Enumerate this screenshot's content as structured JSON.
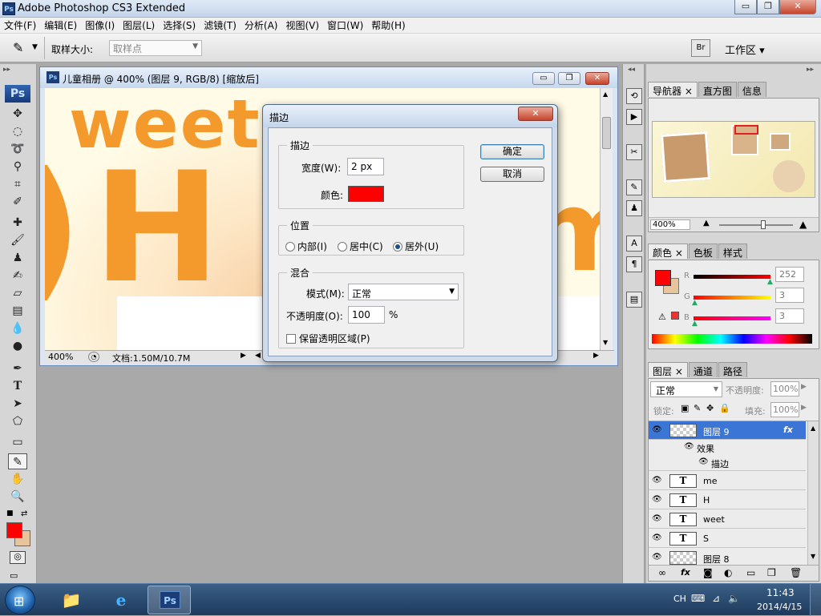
{
  "app": {
    "title": "Adobe Photoshop CS3 Extended",
    "logo": "Ps"
  },
  "window_controls": {
    "minimize": "▭",
    "restore": "❐",
    "close": "✕"
  },
  "menu": [
    "文件(F)",
    "编辑(E)",
    "图像(I)",
    "图层(L)",
    "选择(S)",
    "滤镜(T)",
    "分析(A)",
    "视图(V)",
    "窗口(W)",
    "帮助(H)"
  ],
  "options": {
    "sample_size_label": "取样大小:",
    "sample_size_value": "取样点",
    "workspace_label": "工作区 ▾"
  },
  "toolbox": {
    "logo": "Ps"
  },
  "document": {
    "title": "儿童相册 @ 400% (图层 9, RGB/8) [缩放后]",
    "zoom": "400%",
    "doc_info": "文档:1.50M/10.7M",
    "canvas_texts": {
      "weet": "weet",
      "h": "H",
      "paren": ")",
      "m": "m"
    }
  },
  "dialog": {
    "title": "描边",
    "stroke_group": "描边",
    "width_label": "宽度(W):",
    "width_value": "2 px",
    "color_label": "颜色:",
    "color_value": "#ff0000",
    "position_group": "位置",
    "inside": "内部(I)",
    "center": "居中(C)",
    "outside": "居外(U)",
    "blend_group": "混合",
    "mode_label": "模式(M):",
    "mode_value": "正常",
    "opacity_label": "不透明度(O):",
    "opacity_value": "100",
    "opacity_unit": "%",
    "preserve": "保留透明区域(P)",
    "ok": "确定",
    "cancel": "取消"
  },
  "navigator": {
    "tabs": [
      "导航器",
      "直方图",
      "信息"
    ],
    "zoom": "400%"
  },
  "color_panel": {
    "tabs": [
      "颜色",
      "色板",
      "样式"
    ],
    "r_label": "R",
    "r_value": "252",
    "g_label": "G",
    "g_value": "3",
    "b_label": "B",
    "b_value": "3",
    "foreground": "#fc0303",
    "background": "#e8c49c"
  },
  "layers_panel": {
    "tabs": [
      "图层",
      "通道",
      "路径"
    ],
    "blend_mode": "正常",
    "opacity_label": "不透明度:",
    "opacity_value": "100%",
    "lock_label": "锁定:",
    "fill_label": "填充:",
    "fill_value": "100%",
    "selected_layer": "图层 9",
    "fx_badge": "fx",
    "effects_label": "效果",
    "stroke_effect": "描边",
    "text_layers": [
      "me",
      "H",
      "weet",
      "S"
    ],
    "bottom_layer": "图层 8",
    "text_thumb": "T"
  },
  "taskbar": {
    "lang": "CH",
    "time": "11:43",
    "date": "2014/4/15",
    "ps_label": "Ps"
  }
}
